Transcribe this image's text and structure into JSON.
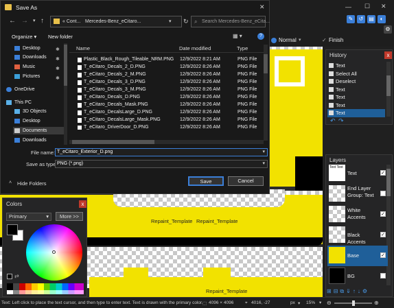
{
  "topbar": {
    "blend_mode": "Normal",
    "finish_label": "Finish",
    "minimize": "—",
    "maximize": "☐",
    "close": "✕"
  },
  "canvas": {
    "labels": [
      "Repaint_Template",
      "Repaint_Template",
      "Repaint_Template"
    ]
  },
  "history": {
    "title": "History",
    "items": [
      "Text",
      "Select All",
      "Deselect",
      "Text",
      "Text",
      "Text",
      "Text"
    ],
    "selected_index": 6,
    "undo": "↶",
    "redo": "↷"
  },
  "layers": {
    "title": "Layers",
    "items": [
      {
        "name": "Text",
        "checked": true
      },
      {
        "name": "End Layer Group: Text",
        "checked": false
      },
      {
        "name": "White Accents",
        "checked": true
      },
      {
        "name": "Black Accents",
        "checked": true
      },
      {
        "name": "Base",
        "checked": true
      },
      {
        "name": "BG",
        "checked": false
      }
    ],
    "selected_index": 4,
    "thumb_text": "Text"
  },
  "dialog": {
    "title": "Save As",
    "close": "✕",
    "breadcrumb_prefix": "« Cont...",
    "breadcrumb_folder": "Mercedes-Benz_eCitaro...",
    "search_placeholder": "Search Mercedes-Benz_eCita...",
    "organize": "Organize ▾",
    "new_folder": "New folder",
    "help": "?",
    "columns": {
      "name": "Name",
      "date": "Date modified",
      "type": "Type"
    },
    "nav": [
      "Desktop",
      "Downloads",
      "Music",
      "Pictures",
      "OneDrive",
      "This PC",
      "3D Objects",
      "Desktop",
      "Documents",
      "Downloads"
    ],
    "files": [
      {
        "name": "Plastic_Black_Rough_Tileable_NRM.PNG",
        "date": "12/9/2022 8:21 AM",
        "type": "PNG File"
      },
      {
        "name": "T_eCitaro_Decals_2_D.PNG",
        "date": "12/9/2022 8:26 AM",
        "type": "PNG File"
      },
      {
        "name": "T_eCitaro_Decals_2_M.PNG",
        "date": "12/9/2022 8:26 AM",
        "type": "PNG File"
      },
      {
        "name": "T_eCitaro_Decals_3_D.PNG",
        "date": "12/9/2022 8:26 AM",
        "type": "PNG File"
      },
      {
        "name": "T_eCitaro_Decals_3_M.PNG",
        "date": "12/9/2022 8:26 AM",
        "type": "PNG File"
      },
      {
        "name": "T_eCitaro_Decals_D.PNG",
        "date": "12/9/2022 8:26 AM",
        "type": "PNG File"
      },
      {
        "name": "T_eCitaro_Decals_Mask.PNG",
        "date": "12/9/2022 8:26 AM",
        "type": "PNG File"
      },
      {
        "name": "T_eCitaro_DecalsLarge_D.PNG",
        "date": "12/9/2022 8:26 AM",
        "type": "PNG File"
      },
      {
        "name": "T_eCitaro_DecalsLarge_Mask.PNG",
        "date": "12/9/2022 8:26 AM",
        "type": "PNG File"
      },
      {
        "name": "T_eCitaro_DriverDoor_D.PNG",
        "date": "12/9/2022 8:26 AM",
        "type": "PNG File"
      }
    ],
    "file_name_label": "File name:",
    "file_name_value": "T_eCitaro_Exterior_D.png",
    "save_type_label": "Save as type:",
    "save_type_value": "PNG (*.png)",
    "hide_folders": "Hide Folders",
    "save_button": "Save",
    "cancel_button": "Cancel"
  },
  "colors": {
    "title": "Colors",
    "close": "x",
    "mode": "Primary",
    "more_button": "More >>",
    "primary_color": "#000000",
    "secondary_color": "#ffffff"
  },
  "status": {
    "hint": "Text: Left click to place the text cursor, and then type to enter text. Text is drawn with the primary color.",
    "image_size": "4096 × 4096",
    "cursor_pos": "4016, -27",
    "units": "px",
    "zoom": "15%"
  }
}
